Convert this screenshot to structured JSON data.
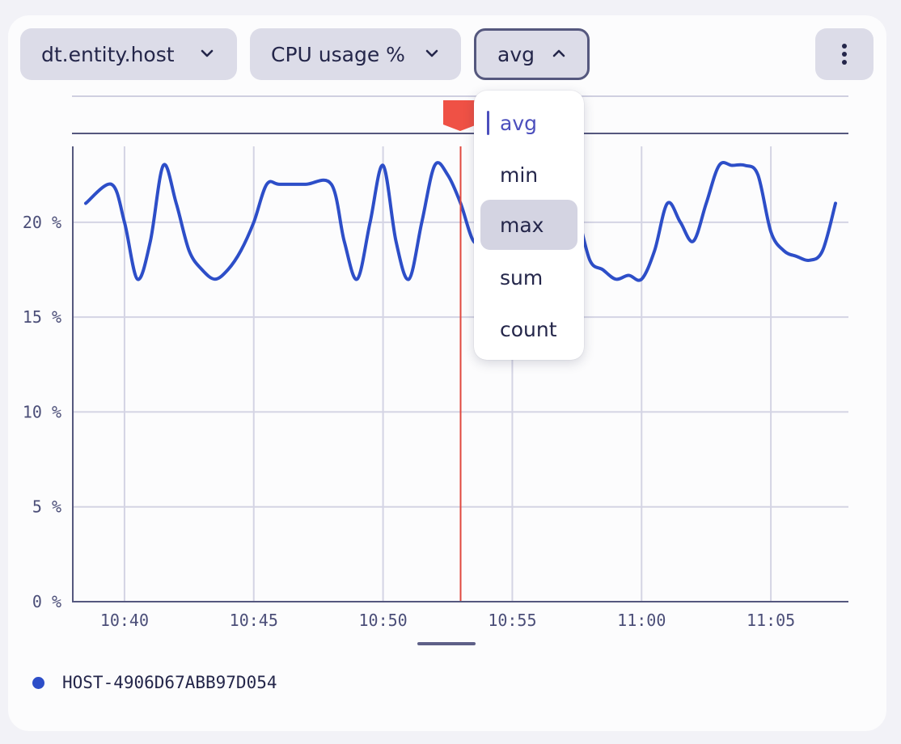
{
  "toolbar": {
    "entity_label": "dt.entity.host",
    "metric_label": "CPU usage %",
    "aggregation_label": "avg"
  },
  "dropdown": {
    "options": [
      "avg",
      "min",
      "max",
      "sum",
      "count"
    ],
    "selected": "avg",
    "hovered": "max"
  },
  "colors": {
    "series": "#2d4ec8",
    "marker": "#e0483e",
    "accent": "#4c4fbd"
  },
  "chart_data": {
    "type": "line",
    "ylim": [
      0,
      24
    ],
    "y_ticks": [
      "0 %",
      "5 %",
      "10 %",
      "15 %",
      "20 %"
    ],
    "y_tick_values": [
      0,
      5,
      10,
      15,
      20
    ],
    "x_tick_labels": [
      "10:40",
      "10:45",
      "10:50",
      "10:55",
      "11:00",
      "11:05"
    ],
    "x_tick_minutes": [
      40,
      45,
      50,
      55,
      60,
      65
    ],
    "xlim_minutes": [
      38,
      68
    ],
    "marker_minute": 53,
    "series": [
      {
        "name": "HOST-4906D67ABB97D054",
        "minutes": [
          38.5,
          39.5,
          40,
          40.5,
          41,
          41.5,
          42,
          42.5,
          43,
          43.5,
          44,
          44.5,
          45,
          45.5,
          46,
          47,
          48,
          48.5,
          49,
          49.5,
          50,
          50.5,
          51,
          51.5,
          52,
          52.5,
          53,
          53.5,
          54,
          54.5,
          55,
          55.5,
          56,
          56.5,
          57,
          57.5,
          58,
          58.5,
          59,
          59.5,
          60,
          60.5,
          61,
          61.5,
          62,
          62.5,
          63,
          63.5,
          64,
          64.5,
          65,
          65.5,
          66,
          66.5,
          67,
          67.5
        ],
        "values": [
          21,
          22,
          20,
          17,
          19,
          23,
          21,
          18.5,
          17.5,
          17,
          17.5,
          18.5,
          20,
          22,
          22,
          22,
          22,
          19,
          17,
          20,
          23,
          19,
          17,
          20,
          23,
          22.5,
          21,
          19,
          19,
          18,
          17.5,
          18.5,
          20,
          21,
          22,
          20.5,
          18,
          17.5,
          17,
          17.2,
          17,
          18.5,
          21,
          20,
          19,
          21,
          23,
          23,
          23,
          22.5,
          19.5,
          18.5,
          18.2,
          18,
          18.5,
          21
        ]
      }
    ]
  },
  "legend": {
    "series_label": "HOST-4906D67ABB97D054"
  }
}
